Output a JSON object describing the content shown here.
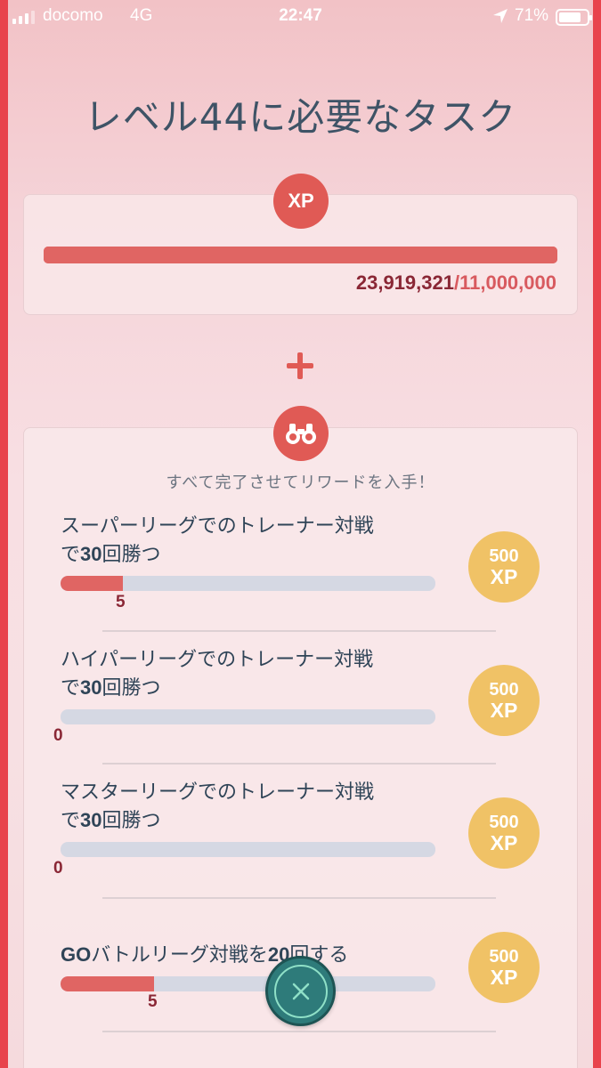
{
  "status_bar": {
    "carrier": "docomo",
    "network": "4G",
    "time": "22:47",
    "battery_percent": "71%"
  },
  "page": {
    "title": "レベル44に必要なタスク"
  },
  "xp_requirement": {
    "badge": "XP",
    "current": "23,919,321",
    "required": "/11,000,000",
    "progress_fraction": 1.0
  },
  "tasks_section": {
    "subtitle": "すべて完了させてリワードを入手！",
    "tasks": [
      {
        "title_line1": "スーパーリーグでのトレーナー対戦",
        "title_pre": "で",
        "title_bold": "30",
        "title_post": "回勝つ",
        "progress": "5",
        "progress_fraction": 0.167,
        "reward_amount": "500",
        "reward_unit": "XP"
      },
      {
        "title_line1": "ハイパーリーグでのトレーナー対戦",
        "title_pre": "で",
        "title_bold": "30",
        "title_post": "回勝つ",
        "progress": "0",
        "progress_fraction": 0,
        "reward_amount": "500",
        "reward_unit": "XP"
      },
      {
        "title_line1": "マスターリーグでのトレーナー対戦",
        "title_pre": "で",
        "title_bold": "30",
        "title_post": "回勝つ",
        "progress": "0",
        "progress_fraction": 0,
        "reward_amount": "500",
        "reward_unit": "XP"
      },
      {
        "title_bold_pre": "GO",
        "title_rest": "バトルリーグ対戦を",
        "title_bold": "20",
        "title_post": "回する",
        "progress": "5",
        "progress_fraction": 0.25,
        "reward_amount": "500",
        "reward_unit": "XP"
      }
    ]
  },
  "icons": {
    "xp_badge_color": "#e05a55",
    "reward_color": "#f0c266",
    "close_button_color": "#2e7b7a",
    "frame_color": "#e8434c"
  }
}
